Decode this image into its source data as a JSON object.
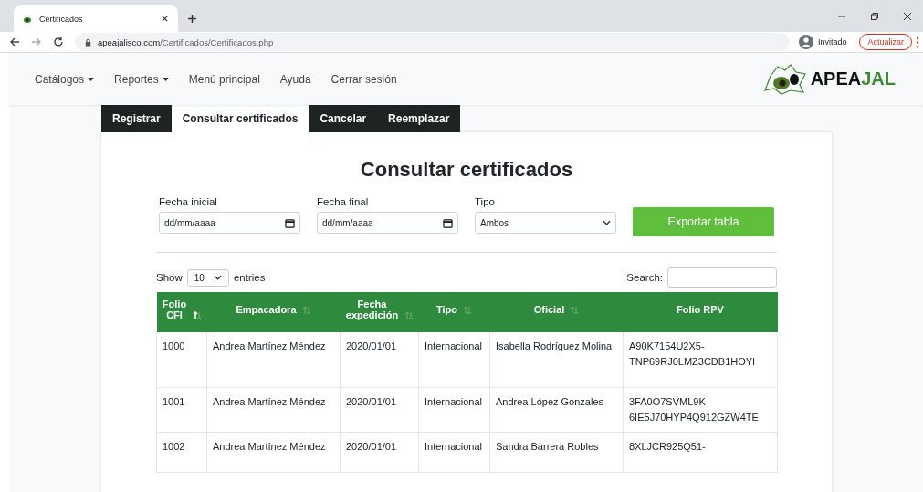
{
  "browser": {
    "tab_title": "Certificados",
    "url_host": "apeajalisco.com",
    "url_path": "/Certificados/Certificados.php",
    "profile": "Invitado",
    "update_button": "Actualizar"
  },
  "navbar": {
    "items": [
      {
        "label": "Catálogos",
        "dropdown": true
      },
      {
        "label": "Reportes",
        "dropdown": true
      },
      {
        "label": "Menú principal",
        "dropdown": false
      },
      {
        "label": "Ayuda",
        "dropdown": false
      },
      {
        "label": "Cerrar sesión",
        "dropdown": false
      }
    ],
    "logo_parts": [
      "APEA",
      "JAL"
    ]
  },
  "tabs": [
    {
      "label": "Registrar",
      "selected": false
    },
    {
      "label": "Consultar certificados",
      "selected": true
    },
    {
      "label": "Cancelar",
      "selected": false
    },
    {
      "label": "Reemplazar",
      "selected": false
    }
  ],
  "page_title": "Consultar certificados",
  "filters": [
    {
      "kind": "date",
      "label": "Fecha inicial",
      "placeholder": "dd/mm/aaaa"
    },
    {
      "kind": "date",
      "label": "Fecha final",
      "placeholder": "dd/mm/aaaa"
    },
    {
      "kind": "select",
      "label": "Tipo",
      "value": "Ambos"
    }
  ],
  "export_button": "Exportar tabla",
  "length": {
    "before": "Show",
    "value": "10",
    "after": "entries"
  },
  "search": {
    "label": "Search:"
  },
  "table": {
    "columns": [
      {
        "label": "Folio CFI",
        "sorted": true
      },
      {
        "label": "Empacadora",
        "sorted": false
      },
      {
        "label": "Fecha expedición",
        "sorted": false
      },
      {
        "label": "Tipo",
        "sorted": false
      },
      {
        "label": "Oficial",
        "sorted": false
      },
      {
        "label": "Folio RPV"
      }
    ],
    "rows": [
      [
        "1000",
        "Andrea Martínez Méndez",
        "2020/01/01",
        "Internacional",
        "Isabella Rodríguez Molina",
        "A90K7154U2X5- TNP69RJ0LMZ3CDB1HOYI"
      ],
      [
        "1001",
        "Andrea Martínez Méndez",
        "2020/01/01",
        "Internacional",
        "Andrea López Gonzales",
        "3FA0O7SVML9K- 6IE5J70HYP4Q912GZW4TE"
      ],
      [
        "1002",
        "Andrea Martínez Méndez",
        "2020/01/01",
        "Internacional",
        "Sandra Barrera Robles",
        "8XLJCR925Q51-"
      ]
    ]
  }
}
